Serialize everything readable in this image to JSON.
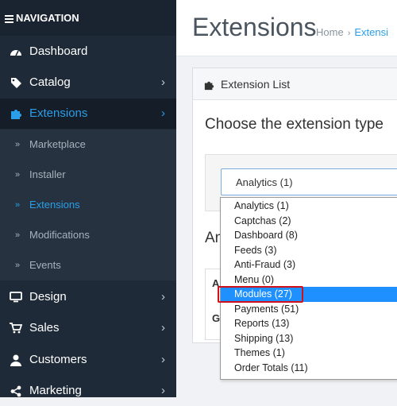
{
  "sidebar": {
    "header": "NAVIGATION",
    "items": [
      {
        "label": "Dashboard",
        "icon": "dashboard-icon",
        "chevron": false
      },
      {
        "label": "Catalog",
        "icon": "tag-icon",
        "chevron": true
      },
      {
        "label": "Extensions",
        "icon": "puzzle-icon",
        "chevron": true,
        "active": true
      },
      {
        "label": "Design",
        "icon": "monitor-icon",
        "chevron": true
      },
      {
        "label": "Sales",
        "icon": "cart-icon",
        "chevron": true
      },
      {
        "label": "Customers",
        "icon": "user-icon",
        "chevron": true
      },
      {
        "label": "Marketing",
        "icon": "share-icon",
        "chevron": true
      }
    ],
    "subitems": [
      {
        "label": "Marketplace"
      },
      {
        "label": "Installer"
      },
      {
        "label": "Extensions",
        "active": true
      },
      {
        "label": "Modifications"
      },
      {
        "label": "Events"
      }
    ]
  },
  "header": {
    "title": "Extensions",
    "breadcrumb": [
      "Home",
      "Extensi"
    ]
  },
  "panel": {
    "title": "Extension List",
    "choose_label": "Choose the extension type",
    "select_value": "Analytics (1)",
    "sub_heading": "An",
    "table_header": "A",
    "table_row": "Go"
  },
  "dropdown": {
    "options": [
      "Analytics (1)",
      "Captchas (2)",
      "Dashboard (8)",
      "Feeds (3)",
      "Anti-Fraud (3)",
      "Menu (0)",
      "Modules (27)",
      "Payments (51)",
      "Reports (13)",
      "Shipping (13)",
      "Themes (1)",
      "Order Totals (11)"
    ],
    "selected_index": 6
  },
  "colors": {
    "sidebar_bg": "#1f2a38",
    "accent": "#2a9ee8",
    "highlight": "#d0101b",
    "selected_option": "#1e90ff"
  }
}
